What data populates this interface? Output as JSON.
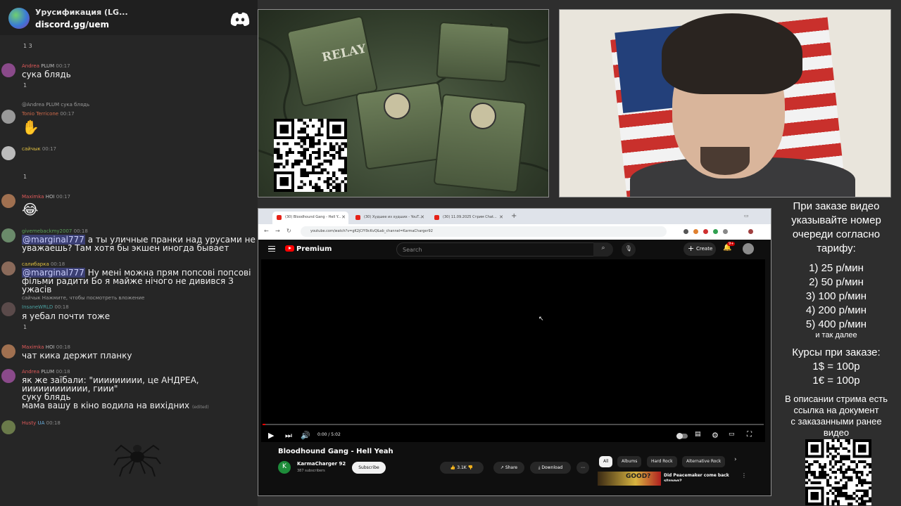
{
  "chat": {
    "server_name": "Урусификация (LG...",
    "server_link": "discord.gg/uem",
    "top_reacts": "1   3",
    "messages": [
      {
        "user": "Andrea",
        "badge": "PLUM",
        "time": "00:17",
        "text": "сука блядь",
        "reacts": "1"
      },
      {
        "reply": "@Andrea PLUM сука блядь",
        "user": "Tonio Terricone",
        "time": "00:17",
        "text": "✋"
      },
      {
        "user": "сайчык",
        "time": "00:17",
        "text": "",
        "reacts": "1"
      },
      {
        "user": "Maximka",
        "badge": "HOI",
        "time": "00:17",
        "text": "😂"
      },
      {
        "user": "givemebackmy2007",
        "time": "00:18",
        "mention": "@marginal777",
        "text": " а ты уличные пранки над урусами не уважаешь? Там хотя бы экшен иногда бывает"
      },
      {
        "user": "салибарка",
        "time": "00:18",
        "mention": "@marginal777",
        "text": " Ну мені можна прям попсові попсові фільми радити Бо я майже нічого не дивився З ужасів"
      },
      {
        "reply": "сайчык Нажмите, чтобы посмотреть вложение",
        "user": "InsaneWRLD",
        "time": "00:18",
        "text": "я уебал почти тоже",
        "reacts": "1"
      },
      {
        "user": "Maximka",
        "badge": "HOI",
        "time": "00:18",
        "text": "чат кика держит планку"
      },
      {
        "user": "Andrea",
        "badge": "PLUM",
        "time": "00:18",
        "text": "як же заїбали: \"иииииииии, це АНДРЕА, ииииииииииии, гиии\"",
        "text2": "суку блядь",
        "text3": "мама вашу в кіно водила на вихідних",
        "edited": "(edited)"
      },
      {
        "user": "Husty",
        "badge": "UA",
        "time": "00:18",
        "text": ""
      }
    ]
  },
  "relay_art": {
    "label": "RELAY"
  },
  "browser": {
    "tabs": [
      "(30) Bloodhound Gang - Hell Y...",
      "(30) Худшее из худших - YouT...",
      "(30) 11.09.2025 Стрим Chat..."
    ],
    "url": "youtube.com/watch?v=gK2jCfY9cKvQ&ab_channel=KarmaCharger92",
    "youtube": {
      "brand": "Premium",
      "search_placeholder": "Search",
      "create_label": "Create",
      "notif_badge": "9+",
      "timecode": "0:00 / 5:02",
      "progress_fraction": 0.005,
      "video_title": "Bloodhound Gang - Hell Yeah",
      "channel_initial": "K",
      "channel_name": "KarmaCharger 92",
      "subscribers": "387 subscribers",
      "subscribe_label": "Subscribe",
      "likes": "3.1K",
      "share_label": "Share",
      "download_label": "Download",
      "chips": [
        "All",
        "Albums",
        "Hard Rock",
        "Alternative Rock"
      ],
      "rec_thumb_text": "GOOD?",
      "rec_title": "Did Peacemaker come back strong?"
    }
  },
  "info": {
    "l1": "При заказе видео",
    "l2": "указывайте номер",
    "l3": "очереди согласно",
    "l4": "тарифу:",
    "p1": "1) 25 р/мин",
    "p2": "2) 50 р/мин",
    "p3": "3) 100 р/мин",
    "p4": "4) 200 р/мин",
    "p5": "5) 400 р/мин",
    "etc": "и так далее",
    "c1": "Курсы при заказе:",
    "c2": "1$ = 100р",
    "c3": "1€ = 100р",
    "d1": "В описании стрима есть",
    "d2": "ссылка на документ",
    "d3": "с заказанными ранее",
    "d4": "видео"
  }
}
